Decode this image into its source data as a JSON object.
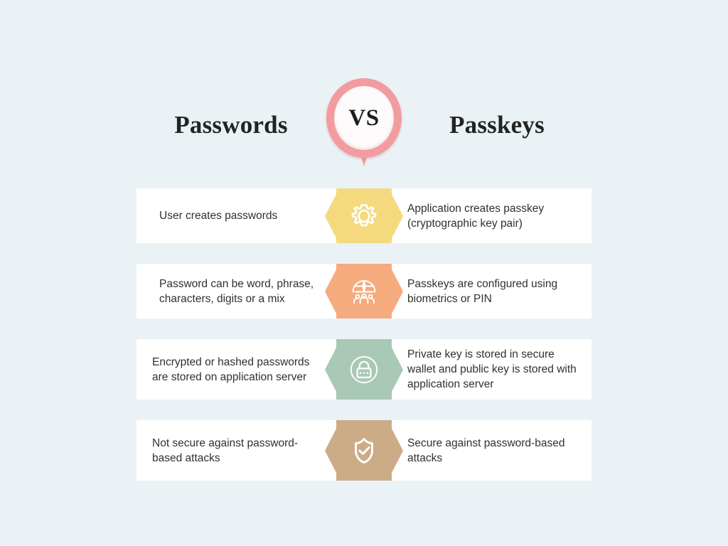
{
  "theme": {
    "background": "#eaf2f5",
    "card_background": "#ffffff",
    "text_color": "#303030",
    "heading_color": "#232323",
    "vs_accent": "#f29ba0"
  },
  "header": {
    "left_title": "Passwords",
    "vs_label": "VS",
    "right_title": "Passkeys"
  },
  "rows": [
    {
      "left_text": "User creates passwords",
      "right_text": "Application creates passkey (cryptographic key pair)",
      "icon": "gear-icon",
      "color": "#f5d97e",
      "lines": 2
    },
    {
      "left_text": "Password can be word, phrase, characters, digits or a mix",
      "right_text": "Passkeys are configured using biometrics or PIN",
      "icon": "globe-people-icon",
      "color": "#f5ab7e",
      "lines": 2
    },
    {
      "left_text": "Encrypted or hashed passwords are stored on application server",
      "right_text": "Private key is stored in secure wallet and public key is stored with application server",
      "icon": "lock-circle-icon",
      "color": "#a9c9b6",
      "lines": 3
    },
    {
      "left_text": "Not secure against password-based attacks",
      "right_text": "Secure against password-based attacks",
      "icon": "shield-check-icon",
      "color": "#ccab87",
      "lines": 2
    }
  ]
}
